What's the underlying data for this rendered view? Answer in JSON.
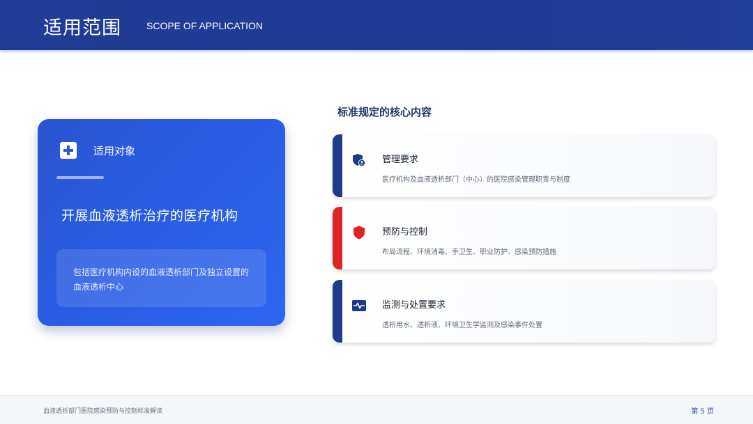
{
  "header": {
    "title": "适用范围",
    "subtitle": "SCOPE OF APPLICATION"
  },
  "left_card": {
    "icon": "medical-cross-icon",
    "label": "适用对象",
    "heading": "开展血液透析治疗的医疗机构",
    "description": "包括医疗机构内设的血液透析部门及独立设置的血液透析中心"
  },
  "section": {
    "title": "标准规定的核心内容"
  },
  "items": [
    {
      "icon": "shield-user-icon",
      "title": "管理要求",
      "description": "医疗机构及血液透析部门（中心）的医院感染管理职责与制度",
      "accent": "#1e3a8a"
    },
    {
      "icon": "shield-icon",
      "title": "预防与控制",
      "description": "布局流程、环境消毒、手卫生、职业防护、感染预防措施",
      "accent": "#dc2626"
    },
    {
      "icon": "monitor-pulse-icon",
      "title": "监测与处置要求",
      "description": "透析用水、透析液、环境卫生学监测及感染事件处置",
      "accent": "#1e3a8a"
    }
  ],
  "footer": {
    "left_text": "血液透析部门医院感染预防与控制标准解读",
    "page_label": "第 5 页"
  },
  "colors": {
    "header_bg": "#1f3d96",
    "card_blue": "#2a5ce3",
    "navy": "#1e3a8a",
    "red": "#dc2626"
  }
}
